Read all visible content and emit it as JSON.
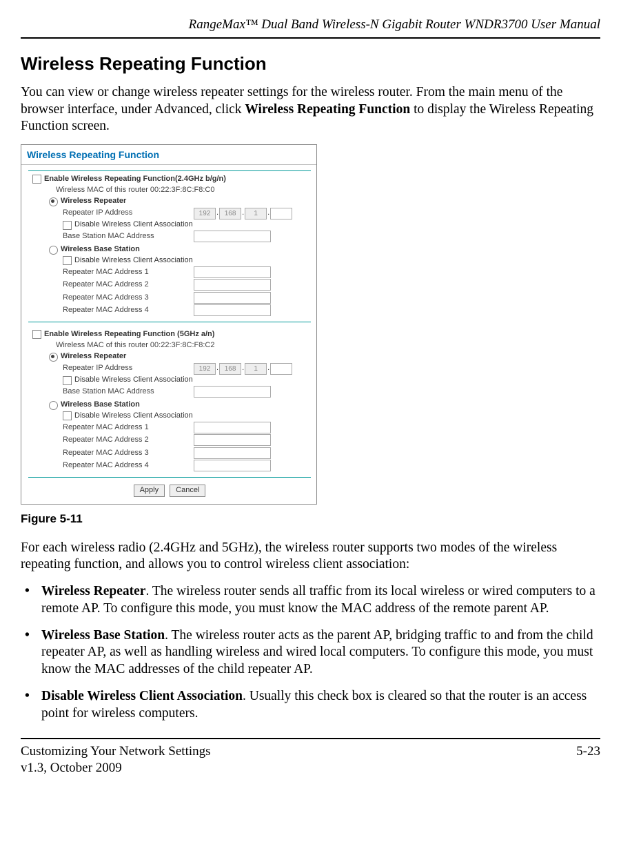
{
  "header": {
    "title": "RangeMax™ Dual Band Wireless-N Gigabit Router WNDR3700 User Manual"
  },
  "section": {
    "title": "Wireless Repeating Function",
    "intro_pre": "You can view or change wireless repeater settings for the wireless router. From the main menu of the browser interface, under Advanced, click ",
    "intro_bold": "Wireless Repeating Function",
    "intro_post": " to display the Wireless Repeating Function screen."
  },
  "figure": {
    "panel_title": "Wireless Repeating Function",
    "band24": {
      "enable_label": "Enable Wireless Repeating Function(2.4GHz b/g/n)",
      "mac_router": "Wireless MAC of this router 00:22:3F:8C:F8:C0",
      "repeater_section": "Wireless Repeater",
      "repeater_ip_label": "Repeater IP Address",
      "ip": [
        "192",
        "168",
        "1",
        ""
      ],
      "disable_assoc": "Disable Wireless Client Association",
      "base_mac_label": "Base Station MAC Address",
      "base_section": "Wireless Base Station",
      "rmac1": "Repeater MAC Address 1",
      "rmac2": "Repeater MAC Address 2",
      "rmac3": "Repeater MAC Address 3",
      "rmac4": "Repeater MAC Address 4"
    },
    "band5": {
      "enable_label": "Enable Wireless Repeating Function (5GHz a/n)",
      "mac_router": "Wireless MAC of this router 00:22:3F:8C:F8:C2",
      "repeater_section": "Wireless Repeater",
      "repeater_ip_label": "Repeater IP Address",
      "ip": [
        "192",
        "168",
        "1",
        ""
      ],
      "disable_assoc": "Disable Wireless Client Association",
      "base_mac_label": "Base Station MAC Address",
      "base_section": "Wireless Base Station",
      "rmac1": "Repeater MAC Address 1",
      "rmac2": "Repeater MAC Address 2",
      "rmac3": "Repeater MAC Address 3",
      "rmac4": "Repeater MAC Address 4"
    },
    "buttons": {
      "apply": "Apply",
      "cancel": "Cancel"
    },
    "caption": "Figure 5-11"
  },
  "body": {
    "para2": "For each wireless radio (2.4GHz and 5GHz), the wireless router supports two modes of the wireless repeating function, and allows you to control wireless client association:",
    "bullets": [
      {
        "lead": "Wireless Repeater",
        "rest": ". The wireless router sends all traffic from its local wireless or wired computers to a remote AP. To configure this mode, you must know the MAC address of the remote parent AP."
      },
      {
        "lead": "Wireless Base Station",
        "rest": ". The wireless router acts as the parent AP, bridging traffic to and from the child repeater AP, as well as handling wireless and wired local computers. To configure this mode, you must know the MAC addresses of the child repeater AP."
      },
      {
        "lead": "Disable Wireless Client Association",
        "rest": ". Usually this check box is cleared so that the router is an access point for wireless computers."
      }
    ]
  },
  "footer": {
    "left": "Customizing Your Network Settings",
    "right": "5-23",
    "center": "v1.3, October 2009"
  }
}
